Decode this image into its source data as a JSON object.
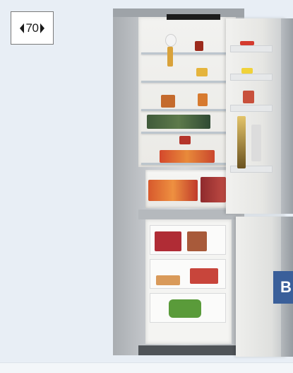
{
  "width_badge": {
    "value": "70"
  },
  "energy_label": {
    "text": "B"
  }
}
